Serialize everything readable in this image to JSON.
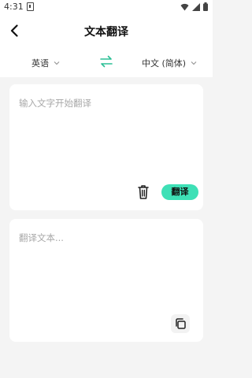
{
  "status": {
    "time": "4:31"
  },
  "header": {
    "title": "文本翻译"
  },
  "languages": {
    "source": "英语",
    "target": "中文 (简体)"
  },
  "input": {
    "placeholder": "输入文字开始翻译",
    "translate_label": "翻译"
  },
  "output": {
    "placeholder": "翻译文本..."
  },
  "colors": {
    "accent": "#3ee0b6",
    "swap": "#2bbf95",
    "background": "#f4f4f4"
  },
  "icons": {
    "back": "back-arrow-icon",
    "swap": "swap-icon",
    "delete": "trash-icon",
    "copy": "copy-icon",
    "caret": "chevron-down-icon",
    "wifi": "wifi-icon",
    "signal": "signal-icon",
    "battery": "battery-icon"
  }
}
